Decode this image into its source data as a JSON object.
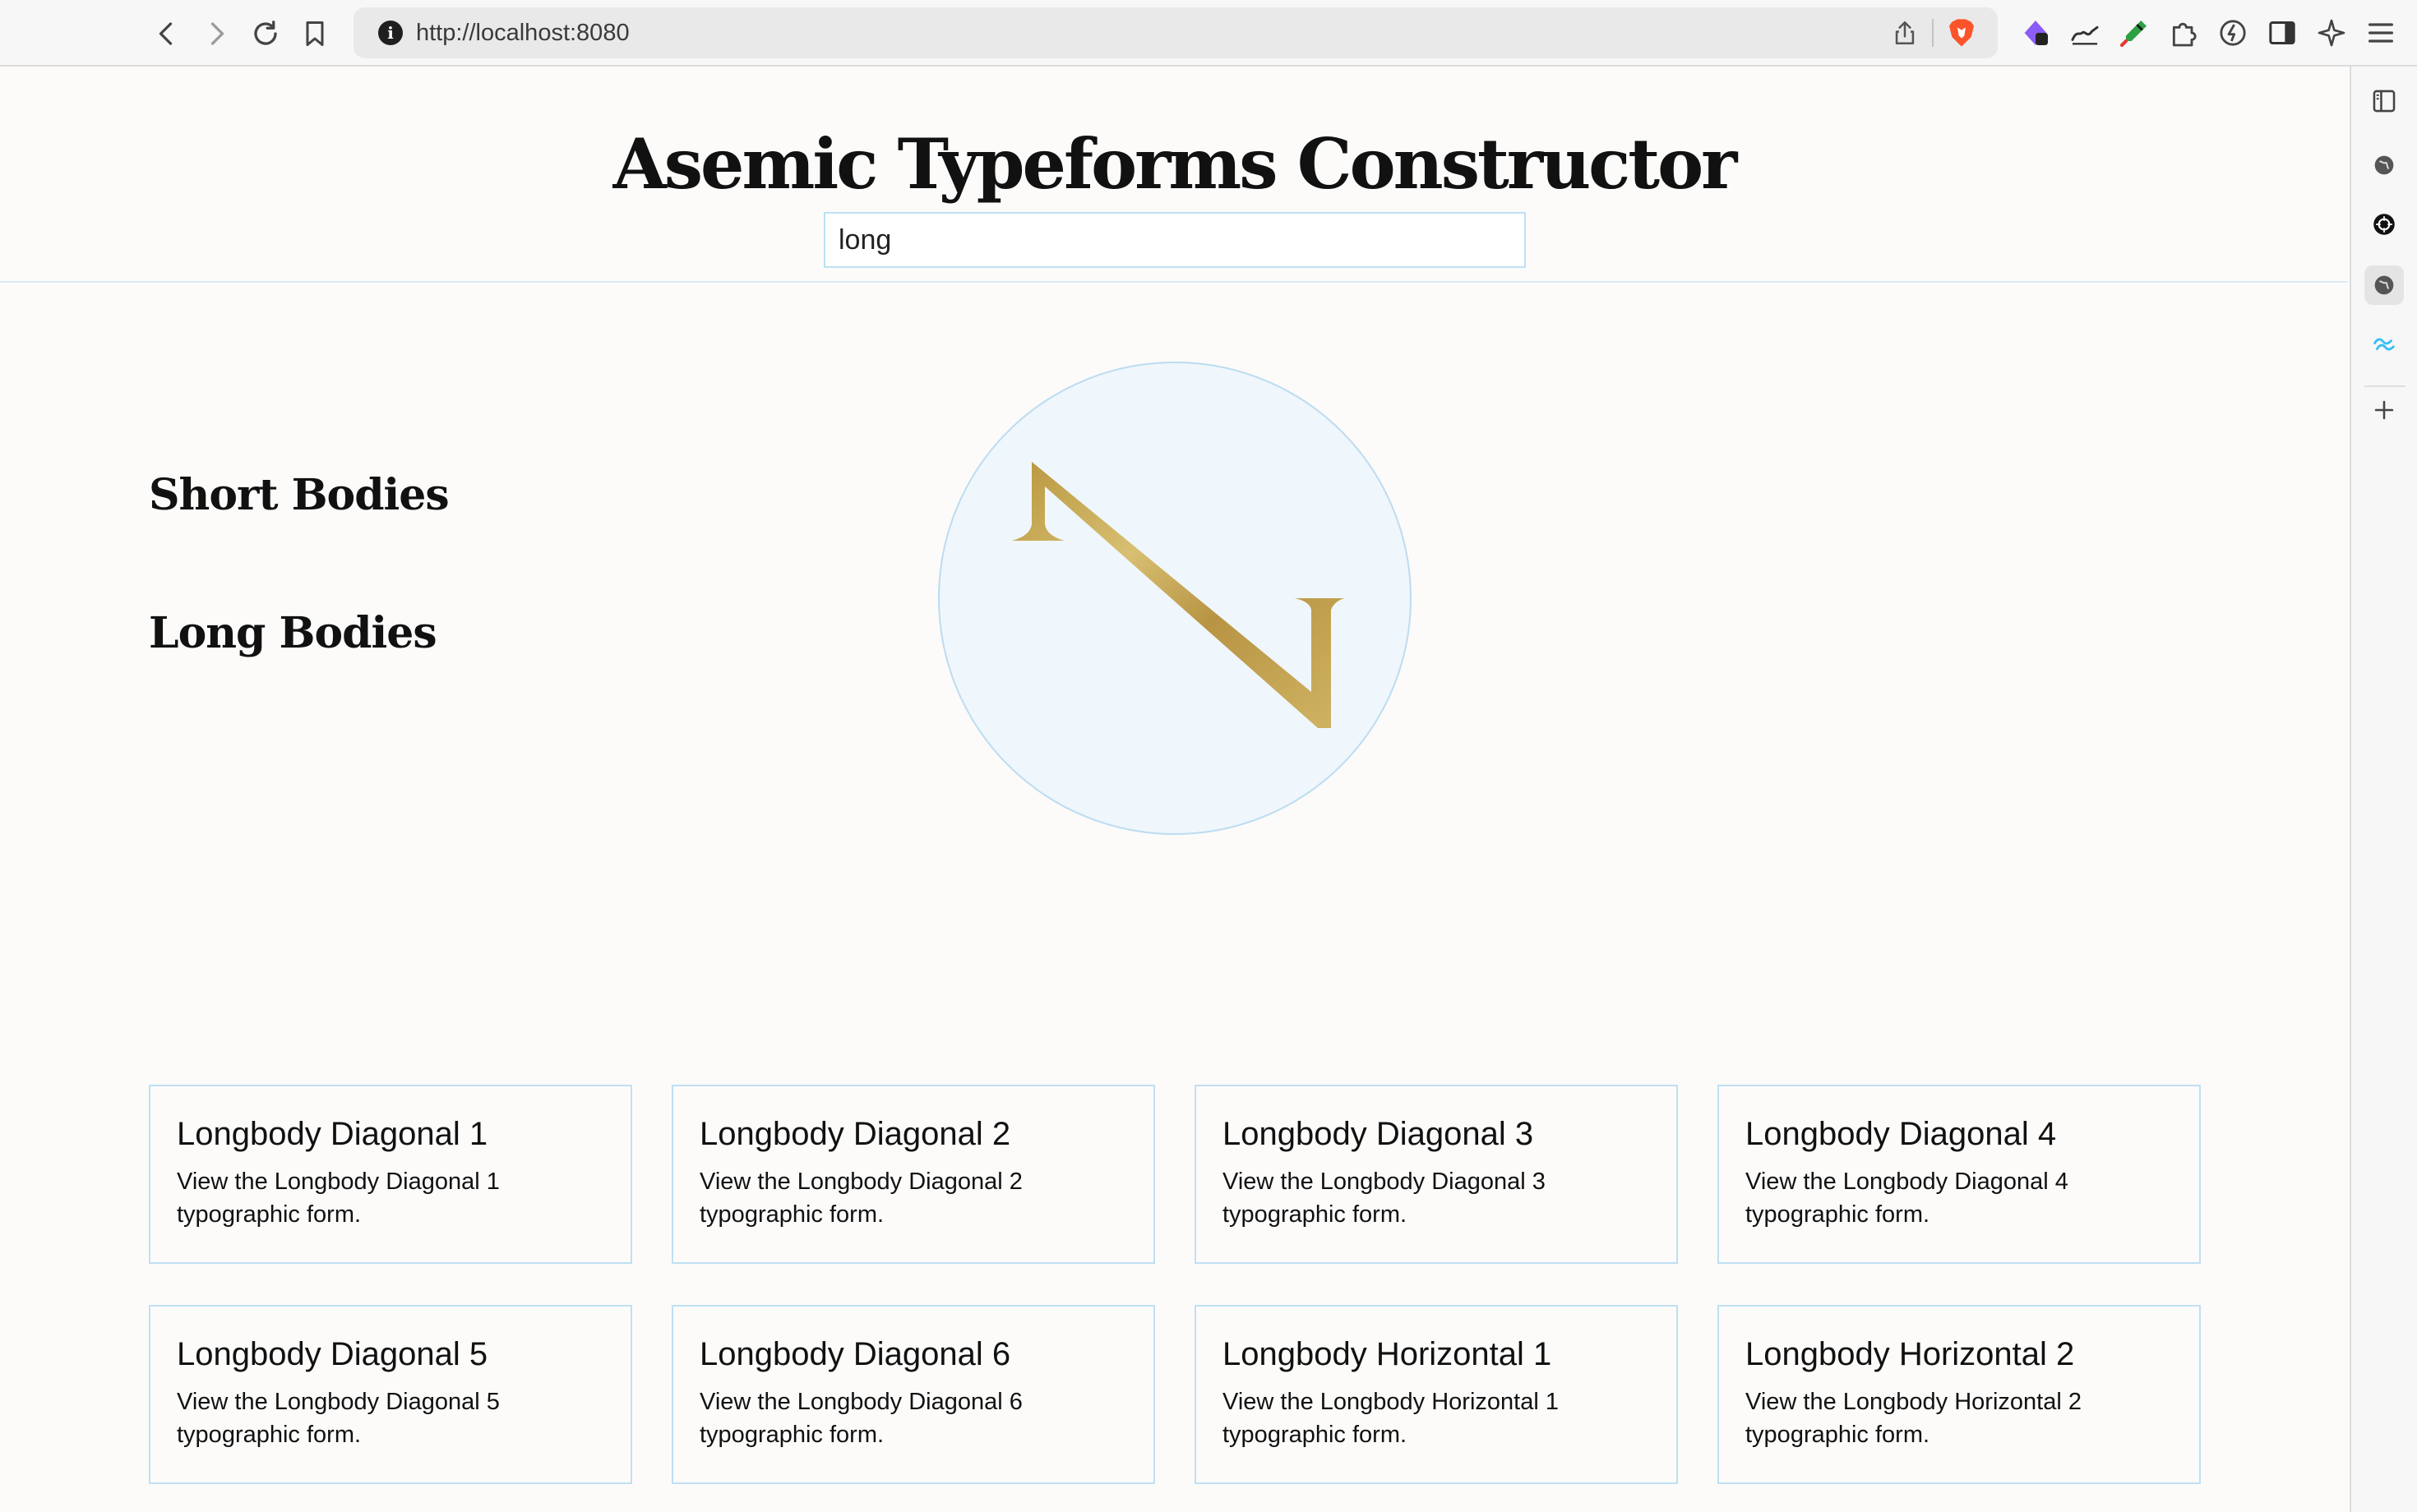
{
  "browser": {
    "url": "http://localhost:8080",
    "info_icon": "i"
  },
  "header": {
    "title": "Asemic Typeforms Constructor",
    "search_value": "long"
  },
  "preview": {
    "glyph_color": "#c9ab55",
    "glyph_name": "longbody-diagonal-glyph"
  },
  "sections": {
    "short_title": "Short Bodies",
    "long_title": "Long Bodies"
  },
  "cards": [
    {
      "title": "Longbody Diagonal 1",
      "desc": "View the Longbody Diagonal 1 typographic form."
    },
    {
      "title": "Longbody Diagonal 2",
      "desc": "View the Longbody Diagonal 2 typographic form."
    },
    {
      "title": "Longbody Diagonal 3",
      "desc": "View the Longbody Diagonal 3 typographic form."
    },
    {
      "title": "Longbody Diagonal 4",
      "desc": "View the Longbody Diagonal 4 typographic form."
    },
    {
      "title": "Longbody Diagonal 5",
      "desc": "View the Longbody Diagonal 5 typographic form."
    },
    {
      "title": "Longbody Diagonal 6",
      "desc": "View the Longbody Diagonal 6 typographic form."
    },
    {
      "title": "Longbody Horizontal 1",
      "desc": "View the Longbody Horizontal 1 typographic form."
    },
    {
      "title": "Longbody Horizontal 2",
      "desc": "View the Longbody Horizontal 2 typographic form."
    }
  ],
  "colors": {
    "accent_border": "#bfe0f3",
    "circle_fill": "#eff6fc",
    "brave_orange": "#fb542b"
  }
}
